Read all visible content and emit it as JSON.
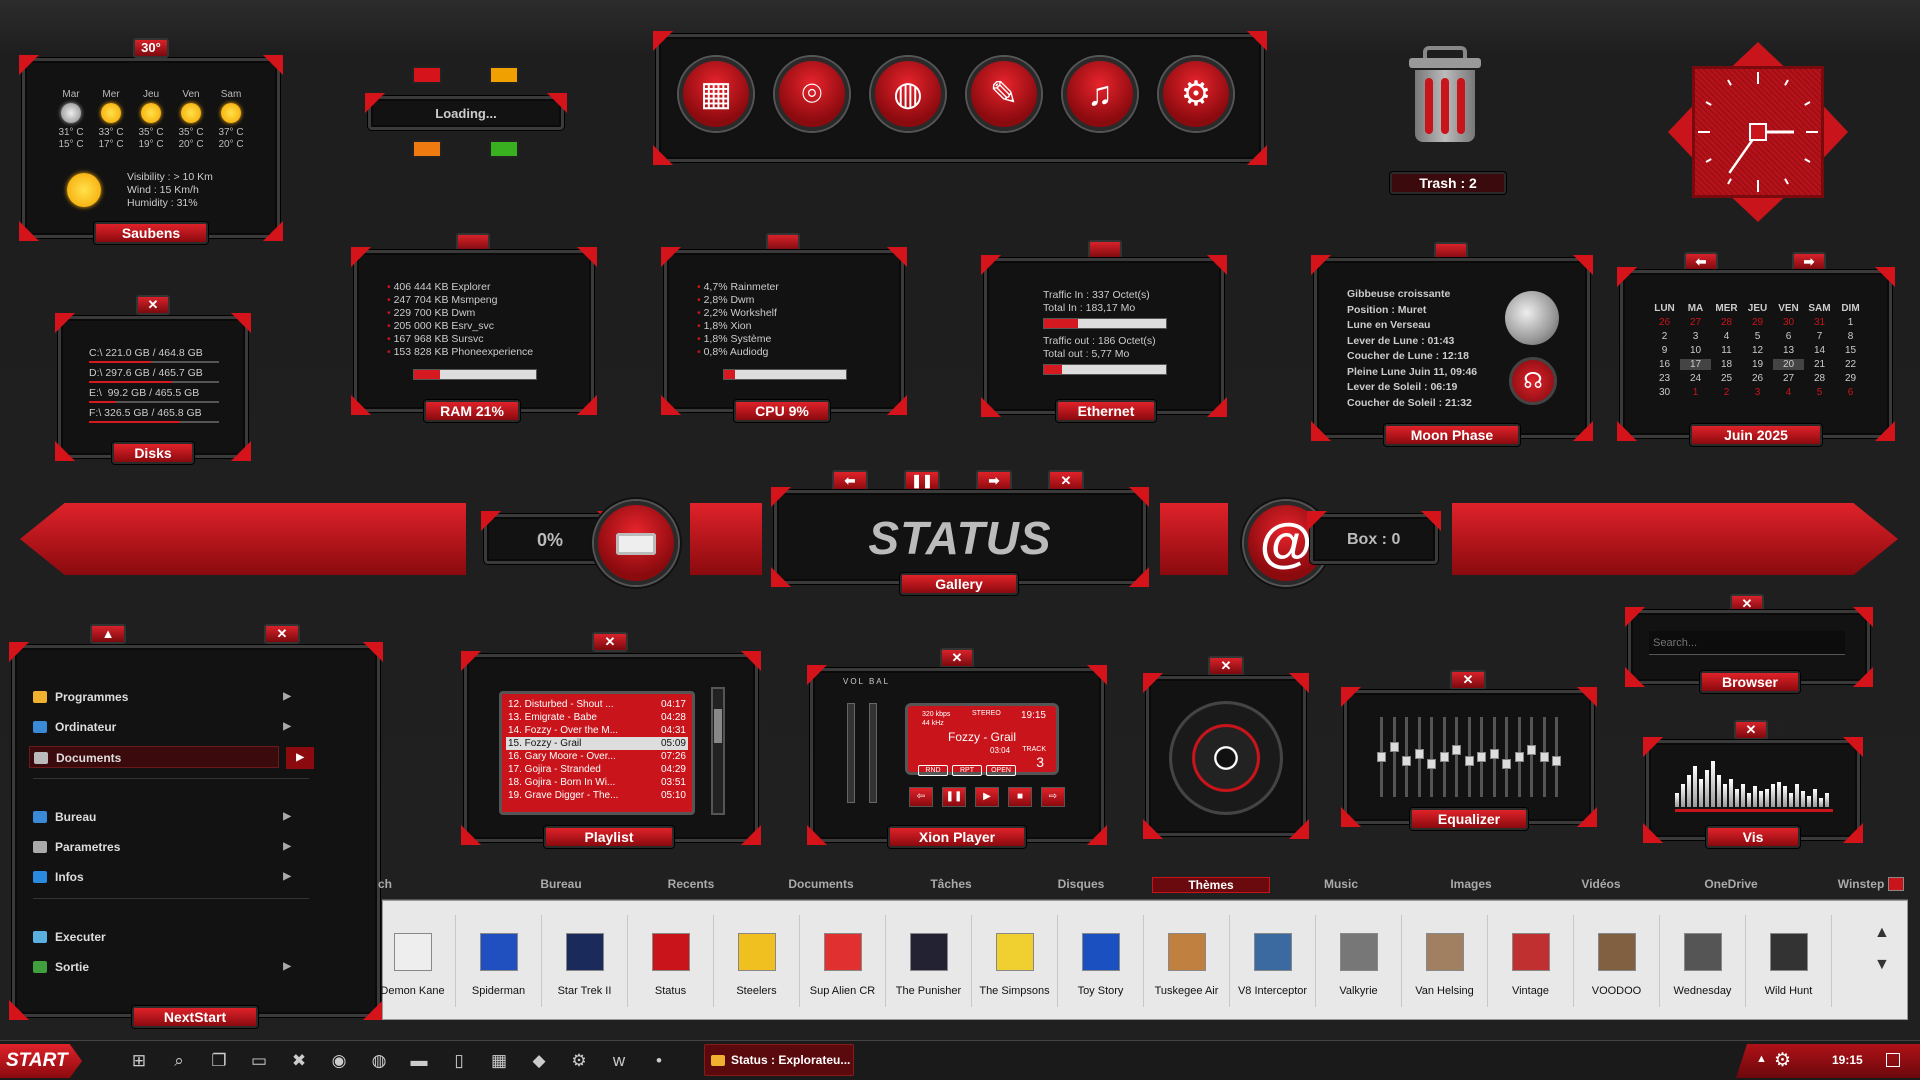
{
  "weather": {
    "temp": "30°",
    "days": [
      "Mar",
      "Mer",
      "Jeu",
      "Ven",
      "Sam"
    ],
    "highs": [
      "31° C",
      "33° C",
      "35° C",
      "35° C",
      "37° C"
    ],
    "lows": [
      "15° C",
      "17° C",
      "19° C",
      "20° C",
      "20° C"
    ],
    "visibility": "Visibility : > 10 Km",
    "wind": "Wind : 15 Km/h",
    "humidity": "Humidity : 31%",
    "location": "Saubens"
  },
  "loading": {
    "text": "Loading..."
  },
  "launcher": {
    "icons": [
      "grid-icon",
      "map-pin-icon",
      "globe-icon",
      "palette-icon",
      "music-icon",
      "gear-icon"
    ]
  },
  "trash": {
    "label": "Trash : 2"
  },
  "disks": {
    "rows": [
      "C:\\ 221.0 GB / 464.8 GB",
      "D:\\ 297.6 GB / 465.7 GB",
      "E:\\  99.2 GB / 465.5 GB",
      "F:\\ 326.5 GB / 465.8 GB"
    ],
    "fill": [
      0.48,
      0.64,
      0.21,
      0.7
    ],
    "label": "Disks"
  },
  "ram": {
    "rows": [
      "406 444 KB Explorer",
      "247 704 KB Msmpeng",
      "229 700 KB Dwm",
      "205 000 KB Esrv_svc",
      "167 968 KB Sursvc",
      "153 828 KB Phoneexperience"
    ],
    "percent": 0.21,
    "label": "RAM 21%"
  },
  "cpu": {
    "rows": [
      "4,7% Rainmeter",
      "2,8% Dwm",
      "2,2% Workshelf",
      "1,8% Xion",
      "1,8% Système",
      "0,8% Audiodg"
    ],
    "percent": 0.09,
    "label": "CPU  9%"
  },
  "ethernet": {
    "in1": "Traffic In : 337 Octet(s)",
    "in2": "Total In : 183,17 Mo",
    "out1": "Traffic out : 186 Octet(s)",
    "out2": "Total out : 5,77 Mo",
    "fill_in": 0.28,
    "fill_out": 0.15,
    "label": "Ethernet"
  },
  "moon": {
    "rows": [
      "Gibbeuse croissante",
      "Position : Muret",
      "Lune en Verseau",
      "Lever de Lune : 01:43",
      "Coucher de Lune : 12:18",
      "Pleine Lune Juin 11, 09:46",
      "Lever de Soleil : 06:19",
      "Coucher de Soleil : 21:32"
    ],
    "label": "Moon Phase"
  },
  "calendar": {
    "headers": [
      "LUN",
      "MA",
      "MER",
      "JEU",
      "VEN",
      "SAM",
      "DIM"
    ],
    "weeks": [
      [
        "26",
        "27",
        "28",
        "29",
        "30",
        "31",
        "1"
      ],
      [
        "2",
        "3",
        "4",
        "5",
        "6",
        "7",
        "8"
      ],
      [
        "9",
        "10",
        "11",
        "12",
        "13",
        "14",
        "15"
      ],
      [
        "16",
        "17",
        "18",
        "19",
        "20",
        "21",
        "22"
      ],
      [
        "23",
        "24",
        "25",
        "26",
        "27",
        "28",
        "29"
      ],
      [
        "30",
        "1",
        "2",
        "3",
        "4",
        "5",
        "6"
      ]
    ],
    "label": "Juin 2025"
  },
  "status": {
    "battery": "0%",
    "title": "STATUS",
    "gallery": "Gallery",
    "box": "Box : 0"
  },
  "start_menu": {
    "items": [
      "Programmes",
      "Ordinateur",
      "Documents",
      "Bureau",
      "Parametres",
      "Infos",
      "Executer",
      "Sortie"
    ],
    "label": "NextStart"
  },
  "playlist": {
    "tracks": [
      [
        "12. Disturbed - Shout ...",
        "04:17"
      ],
      [
        "13. Emigrate - Babe",
        "04:28"
      ],
      [
        "14. Fozzy - Over the M...",
        "04:31"
      ],
      [
        "15. Fozzy - Grail",
        "05:09"
      ],
      [
        "16. Gary Moore - Over...",
        "07:26"
      ],
      [
        "17. Gojira - Stranded",
        "04:29"
      ],
      [
        "18. Gojira - Born In Wi...",
        "03:51"
      ],
      [
        "19. Grave Digger - The...",
        "05:10"
      ]
    ],
    "label": "Playlist"
  },
  "xion": {
    "vol": "VOL",
    "bal": "BAL",
    "kbps": "320",
    "kbps_unit": "kbps",
    "khz": "44",
    "khz_unit": "kHz",
    "stereo": "STEREO",
    "time": "19:15",
    "track_title": "Fozzy - Grail",
    "elapsed": "03:04",
    "track_label": "TRACK",
    "track_num": "3",
    "btns": [
      "RND",
      "RPT",
      "OPEN"
    ],
    "label": "Xion Player"
  },
  "equalizer": {
    "label": "Equalizer",
    "levels": [
      0.5,
      0.35,
      0.55,
      0.45,
      0.6,
      0.5,
      0.4,
      0.55,
      0.5,
      0.45,
      0.6,
      0.5,
      0.4,
      0.5,
      0.55
    ]
  },
  "browser": {
    "placeholder": "Search...",
    "label": "Browser"
  },
  "vis": {
    "label": "Vis",
    "levels": [
      0.3,
      0.5,
      0.7,
      0.9,
      0.6,
      0.8,
      1,
      0.7,
      0.5,
      0.6,
      0.4,
      0.5,
      0.3,
      0.45,
      0.35,
      0.4,
      0.5,
      0.55,
      0.45,
      0.3,
      0.5,
      0.35,
      0.25,
      0.4,
      0.2,
      0.3
    ]
  },
  "clock": {
    "hour_angle": 90,
    "minute_angle": 215
  },
  "dock": {
    "tabs": [
      "ch",
      "Bureau",
      "Recents",
      "Documents",
      "Tâches",
      "Disques",
      "Thèmes",
      "Music",
      "Images",
      "Vidéos",
      "OneDrive",
      "Winstep"
    ],
    "active": "Thèmes",
    "thumbs": [
      "Demon Kane",
      "Spiderman",
      "Star Trek II",
      "Status",
      "Steelers",
      "Sup Alien CR",
      "The Punisher",
      "The Simpsons",
      "Toy Story",
      "Tuskegee Air",
      "V8 Interceptor",
      "Valkyrie",
      "Van Helsing",
      "Vintage",
      "VOODOO",
      "Wednesday",
      "Wild Hunt"
    ]
  },
  "taskbar": {
    "start": "START",
    "window": "Status : Explorateu...",
    "time": "19:15"
  },
  "colors": {
    "accent": "#d4141a",
    "dark": "#121212"
  }
}
